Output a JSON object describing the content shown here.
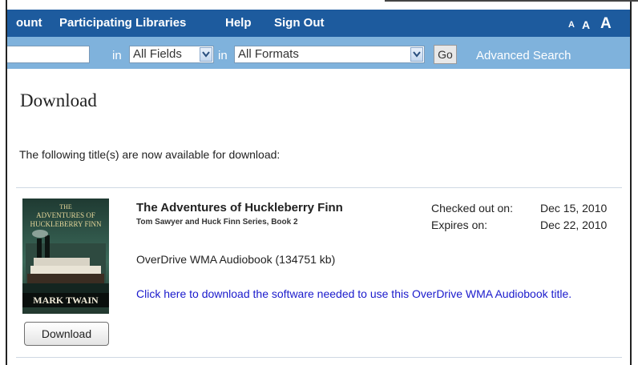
{
  "topnav": {
    "account_label": "ount",
    "libraries_label": "Participating Libraries",
    "help_label": "Help",
    "signout_label": "Sign Out",
    "font_sizes": [
      "A",
      "A",
      "A"
    ]
  },
  "search": {
    "in_label": "in",
    "fields_value": "All Fields",
    "formats_value": "All Formats",
    "go_label": "Go",
    "advanced_label": "Advanced Search"
  },
  "page": {
    "title": "Download",
    "intro": "The following title(s) are now available for download:"
  },
  "book": {
    "title": "The Adventures of Huckleberry Finn",
    "series": "Tom Sawyer and Huck Finn Series, Book 2",
    "checked_out_label": "Checked out on:",
    "checked_out_value": "Dec 15, 2010",
    "expires_label": "Expires on:",
    "expires_value": "Dec 22, 2010",
    "format": "OverDrive WMA Audiobook (134751 kb)",
    "software_link": "Click here to download the software needed to use this OverDrive WMA Audiobook title.",
    "download_label": "Download",
    "cover": {
      "line1": "THE",
      "line2": "ADVENTURES OF",
      "line3": "HUCKLEBERRY FINN",
      "author": "MARK TWAIN"
    }
  },
  "colors": {
    "nav_bg": "#1d5b9e",
    "search_bg": "#7fb2dc",
    "link": "#1a1acc"
  }
}
